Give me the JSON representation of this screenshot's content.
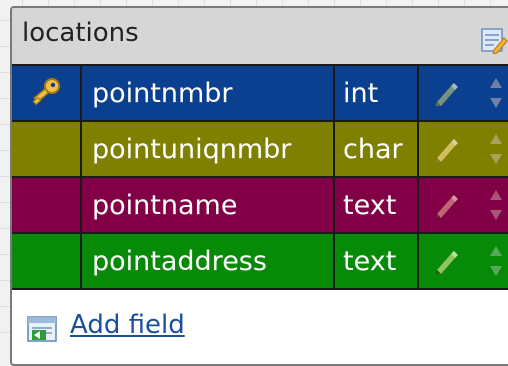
{
  "table": {
    "name": "locations",
    "add_field_label": "Add field",
    "rows": [
      {
        "name": "pointnmbr",
        "type": "int",
        "color": "#0b3f8f",
        "key": true
      },
      {
        "name": "pointuniqnmbr",
        "type": "char",
        "color": "#808000",
        "key": false
      },
      {
        "name": "pointname",
        "type": "text",
        "color": "#820146",
        "key": false
      },
      {
        "name": "pointaddress",
        "type": "text",
        "color": "#078a07",
        "key": false
      }
    ]
  },
  "icons": {
    "table_header": "edit-table-icon",
    "key": "key-icon",
    "edit_field": "pencil-icon",
    "reorder": "move-up-down-icon",
    "add_field": "add-field-icon"
  },
  "colors": {
    "header_bg": "#d6d6d6",
    "link": "#1b4f9c"
  }
}
